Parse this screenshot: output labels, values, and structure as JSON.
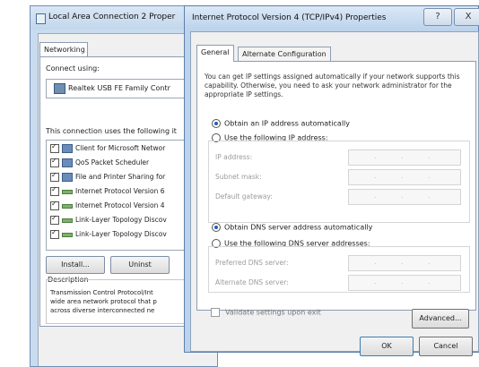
{
  "background_window": {
    "title": "Local Area Connection 2 Proper",
    "tab": "Networking",
    "connect_using_label": "Connect using:",
    "adapter": "Realtek USB FE Family Contr",
    "items_label": "This connection uses the following it",
    "items": [
      "Client for Microsoft Networ",
      "QoS Packet Scheduler",
      "File and Printer Sharing for",
      "Internet Protocol Version 6",
      "Internet Protocol Version 4",
      "Link-Layer Topology Discov",
      "Link-Layer Topology Discov"
    ],
    "install_button": "Install...",
    "uninstall_button": "Uninst",
    "description_label": "Description",
    "description_text": [
      "Transmission Control Protocol/Int",
      "wide area network protocol that p",
      "across diverse interconnected ne"
    ]
  },
  "dialog": {
    "title": "Internet Protocol Version 4 (TCP/IPv4) Properties",
    "help_button": "?",
    "close_button": "X",
    "tabs": [
      {
        "label": "General"
      },
      {
        "label": "Alternate Configuration"
      }
    ],
    "intro": "You can get IP settings assigned automatically if your network supports this capability. Otherwise, you need to ask your network administrator for the appropriate IP settings.",
    "ip_auto_label": "Obtain an IP address automatically",
    "ip_manual_label": "Use the following IP address:",
    "ip_fields": [
      {
        "label": "IP address:"
      },
      {
        "label": "Subnet mask:"
      },
      {
        "label": "Default gateway:"
      }
    ],
    "dns_auto_label": "Obtain DNS server address automatically",
    "dns_manual_label": "Use the following DNS server addresses:",
    "dns_fields": [
      {
        "label": "Preferred DNS server:"
      },
      {
        "label": "Alternate DNS server:"
      }
    ],
    "ip_dots": ".",
    "validate_label": "Validate settings upon exit",
    "advanced_button": "Advanced...",
    "ok_button": "OK",
    "cancel_button": "Cancel"
  }
}
